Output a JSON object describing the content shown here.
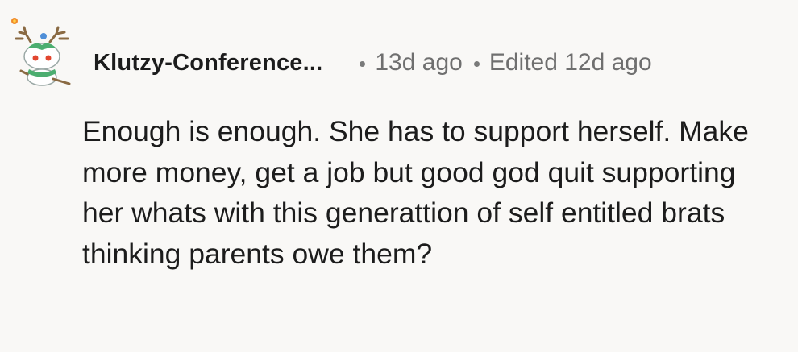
{
  "comment": {
    "author": "Klutzy-Conference...",
    "posted": "13d ago",
    "edited": "Edited 12d ago",
    "body": "Enough is enough. She has to support herself. Make more money, get a job but good god quit supporting her whats with this generattion of self entitled brats thinking parents owe them?",
    "avatar_icon": "snoo-avatar-antlers-icon"
  }
}
